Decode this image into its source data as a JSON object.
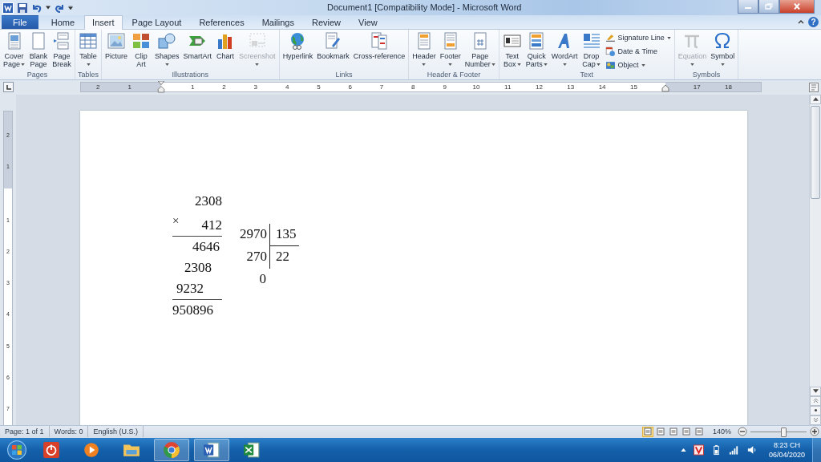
{
  "window": {
    "title": "Document1 [Compatibility Mode]  -  Microsoft Word"
  },
  "tabs": [
    {
      "label": "File",
      "kind": "file",
      "selected": false
    },
    {
      "label": "Home",
      "kind": "tab",
      "selected": false
    },
    {
      "label": "Insert",
      "kind": "tab",
      "selected": true
    },
    {
      "label": "Page Layout",
      "kind": "tab",
      "selected": false
    },
    {
      "label": "References",
      "kind": "tab",
      "selected": false
    },
    {
      "label": "Mailings",
      "kind": "tab",
      "selected": false
    },
    {
      "label": "Review",
      "kind": "tab",
      "selected": false
    },
    {
      "label": "View",
      "kind": "tab",
      "selected": false
    }
  ],
  "help_label": "?",
  "ribbon": {
    "groups": [
      {
        "label": "Pages",
        "buttons": [
          {
            "kind": "large",
            "lines": [
              "Cover",
              "Page"
            ],
            "dropdown": true,
            "disabled": false
          },
          {
            "kind": "large",
            "lines": [
              "Blank",
              "Page"
            ],
            "dropdown": false,
            "disabled": false
          },
          {
            "kind": "large",
            "lines": [
              "Page",
              "Break"
            ],
            "dropdown": false,
            "disabled": false
          }
        ]
      },
      {
        "label": "Tables",
        "buttons": [
          {
            "kind": "large",
            "lines": [
              "Table"
            ],
            "dropdown": true,
            "disabled": false
          }
        ]
      },
      {
        "label": "Illustrations",
        "buttons": [
          {
            "kind": "large",
            "lines": [
              "Picture"
            ],
            "dropdown": false,
            "disabled": false
          },
          {
            "kind": "large",
            "lines": [
              "Clip",
              "Art"
            ],
            "dropdown": false,
            "disabled": false
          },
          {
            "kind": "large",
            "lines": [
              "Shapes"
            ],
            "dropdown": true,
            "disabled": false
          },
          {
            "kind": "large",
            "lines": [
              "SmartArt"
            ],
            "dropdown": false,
            "disabled": false
          },
          {
            "kind": "large",
            "lines": [
              "Chart"
            ],
            "dropdown": false,
            "disabled": false
          },
          {
            "kind": "large",
            "lines": [
              "Screenshot"
            ],
            "dropdown": true,
            "disabled": true
          }
        ]
      },
      {
        "label": "Links",
        "buttons": [
          {
            "kind": "large",
            "lines": [
              "Hyperlink"
            ],
            "dropdown": false,
            "disabled": false
          },
          {
            "kind": "large",
            "lines": [
              "Bookmark"
            ],
            "dropdown": false,
            "disabled": false
          },
          {
            "kind": "large",
            "lines": [
              "Cross-reference"
            ],
            "dropdown": false,
            "disabled": false
          }
        ]
      },
      {
        "label": "Header & Footer",
        "buttons": [
          {
            "kind": "large",
            "lines": [
              "Header"
            ],
            "dropdown": true,
            "disabled": false
          },
          {
            "kind": "large",
            "lines": [
              "Footer"
            ],
            "dropdown": true,
            "disabled": false
          },
          {
            "kind": "large",
            "lines": [
              "Page",
              "Number"
            ],
            "dropdown": true,
            "disabled": false
          }
        ]
      },
      {
        "label": "Text",
        "buttons": [
          {
            "kind": "large",
            "lines": [
              "Text",
              "Box"
            ],
            "dropdown": true,
            "disabled": false
          },
          {
            "kind": "large",
            "lines": [
              "Quick",
              "Parts"
            ],
            "dropdown": true,
            "disabled": false
          },
          {
            "kind": "large",
            "lines": [
              "WordArt"
            ],
            "dropdown": true,
            "disabled": false
          },
          {
            "kind": "large",
            "lines": [
              "Drop",
              "Cap"
            ],
            "dropdown": true,
            "disabled": false
          },
          {
            "kind": "small",
            "lines": [
              "Signature Line"
            ],
            "dropdown": true,
            "disabled": false
          },
          {
            "kind": "small",
            "lines": [
              "Date & Time"
            ],
            "dropdown": false,
            "disabled": false
          },
          {
            "kind": "small",
            "lines": [
              "Object"
            ],
            "dropdown": true,
            "disabled": false
          }
        ]
      },
      {
        "label": "Symbols",
        "buttons": [
          {
            "kind": "large",
            "lines": [
              "Equation"
            ],
            "dropdown": true,
            "disabled": true
          },
          {
            "kind": "large",
            "lines": [
              "Symbol"
            ],
            "dropdown": true,
            "disabled": false
          }
        ]
      }
    ]
  },
  "ruler": {
    "left_labels": [
      "2",
      "1"
    ],
    "body_labels": [
      "1",
      "2",
      "3",
      "4",
      "5",
      "6",
      "7",
      "8",
      "9",
      "10",
      "11",
      "12",
      "13",
      "14",
      "15"
    ],
    "right_labels": [
      "17",
      "18"
    ]
  },
  "vertical_ruler": {
    "top_labels": [
      "2",
      "1"
    ],
    "body_labels": [
      "1",
      "2",
      "3",
      "4",
      "5",
      "6",
      "7"
    ]
  },
  "document": {
    "multiplication": {
      "multiplicand": "2308",
      "sign": "×",
      "multiplier": "412",
      "partial_products": [
        "4646",
        "2308",
        "9232"
      ],
      "product": "950896"
    },
    "division": {
      "dividend": "2970",
      "divisor": "135",
      "remainder_step": "270",
      "quotient": "22",
      "remainder": "0"
    }
  },
  "status_bar": {
    "page": "Page: 1 of 1",
    "words": "Words: 0",
    "language": "English (U.S.)",
    "views": [
      {
        "selected": true
      },
      {
        "selected": false
      },
      {
        "selected": false
      },
      {
        "selected": false
      },
      {
        "selected": false
      }
    ],
    "zoom": "140%",
    "zoom_level": {
      "level": 0.57
    }
  },
  "taskbar": {
    "apps": [
      {
        "active": false
      },
      {
        "active": false
      },
      {
        "active": false
      },
      {
        "active": true
      },
      {
        "active": true
      },
      {
        "active": false
      }
    ],
    "time": "8:23 CH",
    "date": "06/04/2020"
  }
}
